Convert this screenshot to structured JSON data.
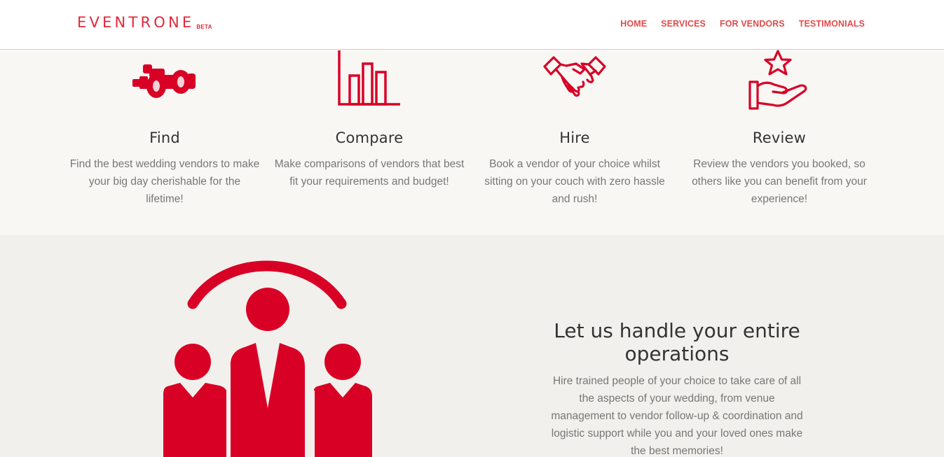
{
  "header": {
    "logo_text": "EVENTRONE",
    "logo_badge": "BETA",
    "nav": [
      {
        "label": "HOME"
      },
      {
        "label": "SERVICES"
      },
      {
        "label": "FOR VENDORS"
      },
      {
        "label": "TESTIMONIALS"
      }
    ]
  },
  "features": [
    {
      "icon": "binoculars-icon",
      "title": "Find",
      "text": "Find the best wedding vendors to make your big day cherishable for the lifetime!"
    },
    {
      "icon": "bar-chart-icon",
      "title": "Compare",
      "text": "Make comparisons of vendors that best fit your requirements and budget!"
    },
    {
      "icon": "handshake-icon",
      "title": "Hire",
      "text": "Book a vendor of your choice whilst sitting on your couch with zero hassle and rush!"
    },
    {
      "icon": "star-hand-icon",
      "title": "Review",
      "text": "Review the vendors you booked, so others like you can benefit from your experience!"
    }
  ],
  "operations": {
    "icon": "team-icon",
    "title": "Let us handle your entire operations",
    "text": "Hire trained people of your choice to take care of all the aspects of your wedding, from venue management to vendor follow-up & coordination and logistic support while you and your loved ones make the best memories!"
  },
  "colors": {
    "brand": "#e5283a",
    "icon_red": "#d90026",
    "nav_text": "#e34a4a"
  }
}
